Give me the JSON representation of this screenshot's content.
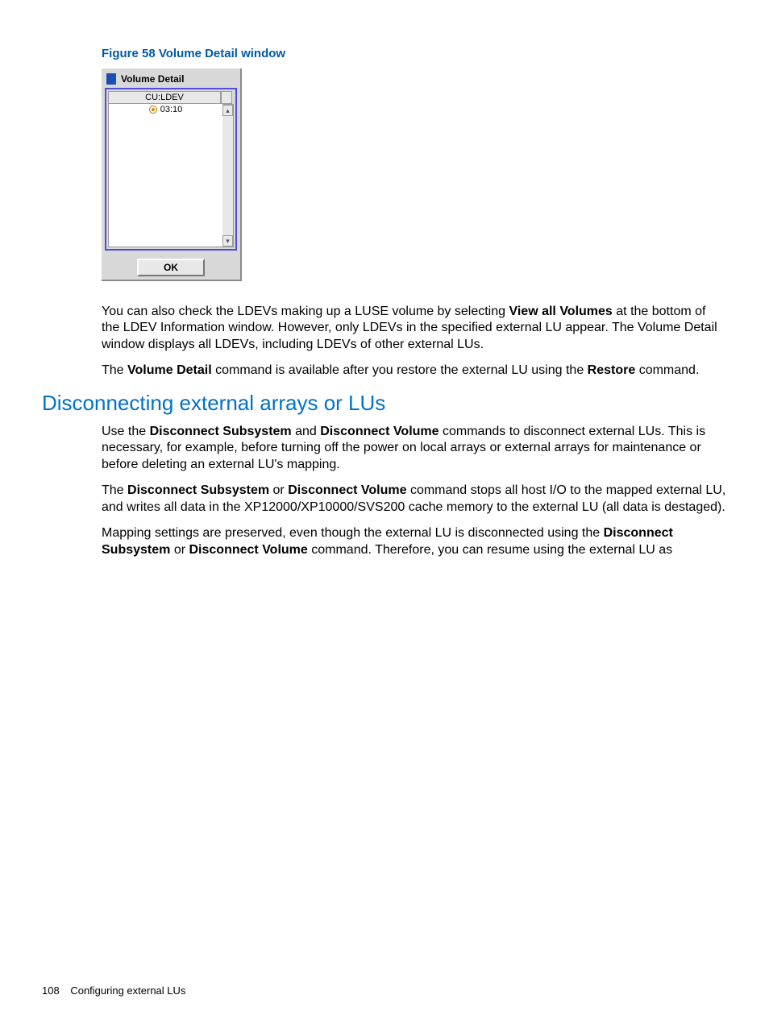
{
  "figure": {
    "caption": "Figure 58 Volume Detail window"
  },
  "dialog": {
    "title": "Volume Detail",
    "column_header": "CU:LDEV",
    "rows": [
      "03:10"
    ],
    "scroll_up_glyph": "▴",
    "scroll_down_glyph": "▾",
    "ok_label": "OK"
  },
  "paragraphs": {
    "p1_a": "You can also check the LDEVs making up a LUSE volume by selecting ",
    "p1_b": "View all Volumes",
    "p1_c": " at the bottom of the LDEV Information window. However, only LDEVs in the specified external LU appear. The Volume Detail window displays all LDEVs, including LDEVs of other external LUs.",
    "p2_a": "The ",
    "p2_b": "Volume Detail",
    "p2_c": " command is available after you restore the external LU using the ",
    "p2_d": "Restore",
    "p2_e": " command.",
    "h2": "Disconnecting external arrays or LUs",
    "p3_a": "Use the ",
    "p3_b": "Disconnect Subsystem",
    "p3_c": " and ",
    "p3_d": "Disconnect Volume",
    "p3_e": " commands to disconnect external LUs. This is necessary, for example, before turning off the power on local arrays or external arrays for maintenance or before deleting an external LU's mapping.",
    "p4_a": "The ",
    "p4_b": "Disconnect Subsystem",
    "p4_c": " or ",
    "p4_d": "Disconnect Volume",
    "p4_e": " command stops all host I/O to the mapped external LU, and writes all data in the XP12000/XP10000/SVS200 cache memory to the external LU (all data is destaged).",
    "p5_a": "Mapping settings are preserved, even though the external LU is disconnected using the ",
    "p5_b": "Disconnect Subsystem",
    "p5_c": " or ",
    "p5_d": "Disconnect Volume",
    "p5_e": " command. Therefore, you can resume using the external LU as"
  },
  "footer": {
    "page_number": "108",
    "section": "Configuring external LUs"
  }
}
